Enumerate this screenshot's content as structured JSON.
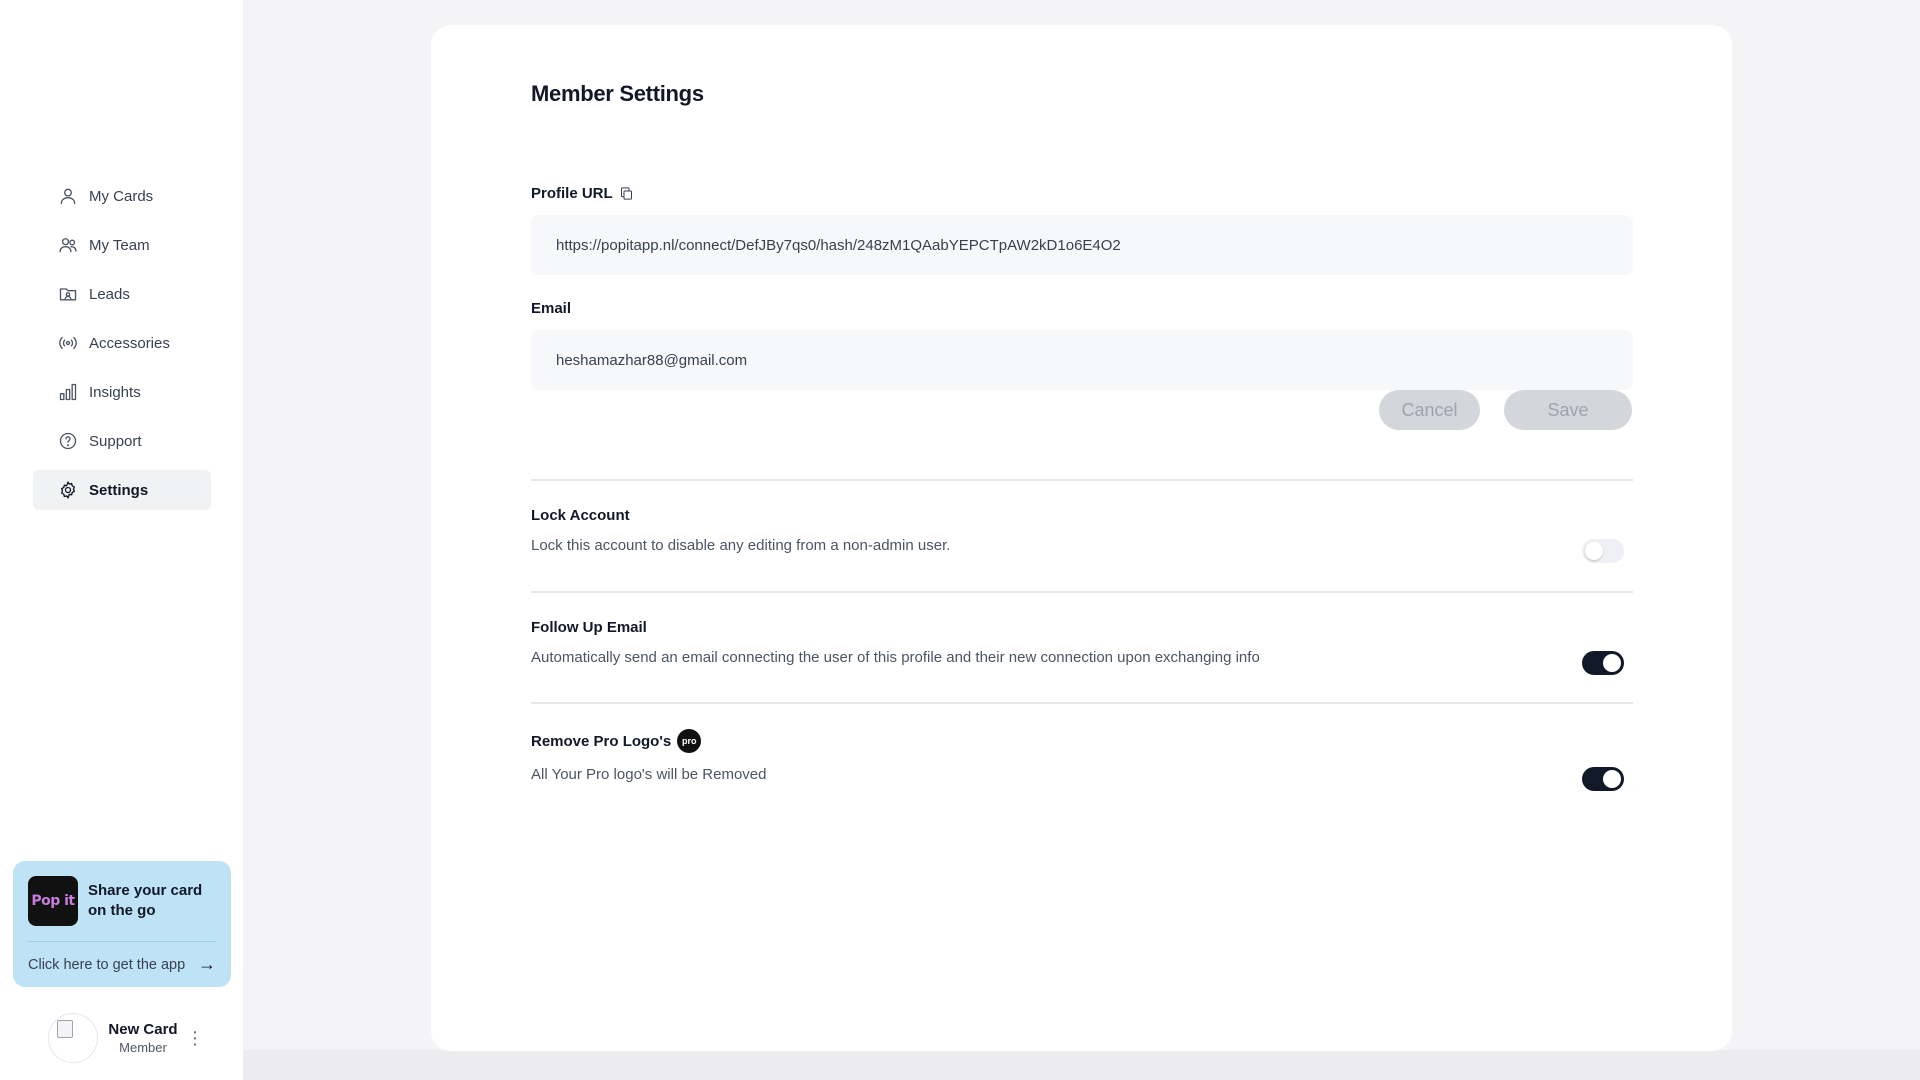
{
  "sidebar": {
    "items": [
      {
        "label": "My Cards",
        "icon": "user-icon"
      },
      {
        "label": "My Team",
        "icon": "team-icon"
      },
      {
        "label": "Leads",
        "icon": "leads-icon"
      },
      {
        "label": "Accessories",
        "icon": "broadcast-icon"
      },
      {
        "label": "Insights",
        "icon": "bar-chart-icon"
      },
      {
        "label": "Support",
        "icon": "help-icon"
      },
      {
        "label": "Settings",
        "icon": "gear-icon",
        "active": true
      }
    ],
    "promo": {
      "logo_text": "Pop it",
      "title": "Share your card on the go",
      "link": "Click here to get the app",
      "arrow": "→"
    },
    "user": {
      "name": "New Card",
      "role": "Member",
      "menu_glyph": "⋮"
    }
  },
  "main": {
    "title": "Member Settings",
    "profile_url": {
      "label": "Profile URL",
      "value": "https://popitapp.nl/connect/DefJBy7qs0/hash/248zM1QAabYEPCTpAW2kD1o6E4O2"
    },
    "email": {
      "label": "Email",
      "value": "heshamazhar88@gmail.com"
    },
    "buttons": {
      "cancel": "Cancel",
      "save": "Save"
    },
    "settings": [
      {
        "title": "Lock Account",
        "description": "Lock this account to disable any editing from a non-admin user.",
        "enabled": false
      },
      {
        "title": "Follow Up Email",
        "description": "Automatically send an email connecting the user of this profile and their new connection upon exchanging info",
        "enabled": true
      },
      {
        "title": "Remove Pro Logo's",
        "badge": "pro",
        "description": "All Your Pro logo's will be Removed",
        "enabled": true
      }
    ]
  },
  "colors": {
    "accent": "#111827",
    "promo_bg": "#bfe3f6",
    "button_disabled": "#d3d6db"
  }
}
